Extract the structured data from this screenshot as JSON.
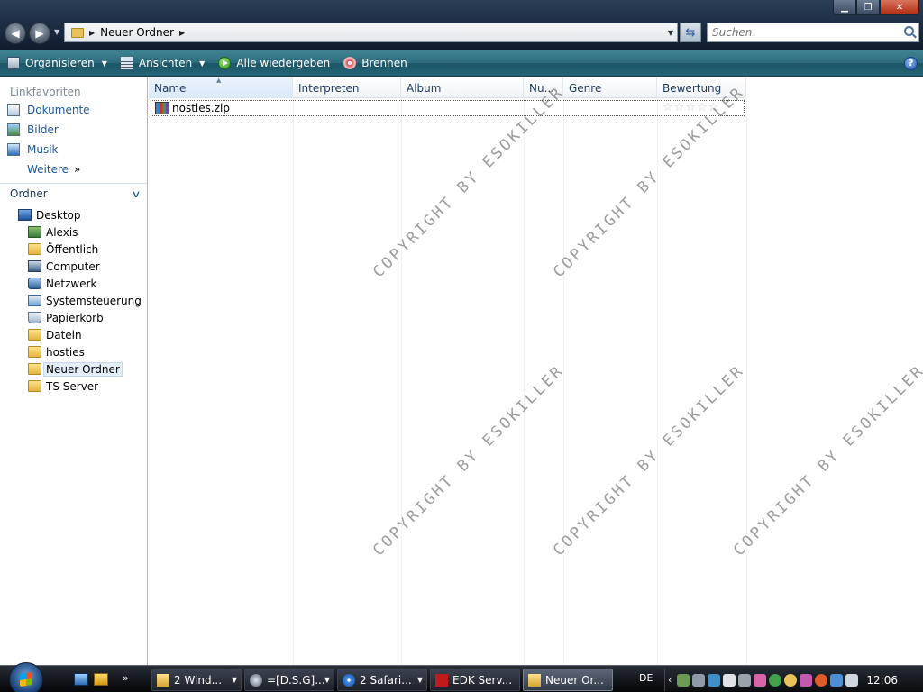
{
  "window": {
    "controls": {
      "minimize": "▁",
      "maximize": "❐",
      "close": "✕"
    }
  },
  "nav": {
    "back_icon": "◀",
    "forward_icon": "▶"
  },
  "address": {
    "path": "Neuer Ordner",
    "separator": "▶"
  },
  "search": {
    "placeholder": "Suchen"
  },
  "toolbar": {
    "organize": "Organisieren",
    "views": "Ansichten",
    "play_all": "Alle wiedergeben",
    "burn": "Brennen",
    "help": "?"
  },
  "sidebar": {
    "favorites_title": "Linkfavoriten",
    "favorites": [
      "Dokumente",
      "Bilder",
      "Musik"
    ],
    "more": "Weitere",
    "more_icon": "»",
    "folders_title": "Ordner",
    "tree_root": "Desktop",
    "tree_items": [
      "Alexis",
      "Öffentlich",
      "Computer",
      "Netzwerk",
      "Systemsteuerung",
      "Papierkorb",
      "Datein",
      "hosties",
      "Neuer Ordner",
      "TS Server"
    ],
    "selected": "Neuer Ordner"
  },
  "columns": [
    "Name",
    "Interpreten",
    "Album",
    "Nu...",
    "Genre",
    "Bewertung"
  ],
  "files": [
    {
      "name": "nosties.zip",
      "rating": 0
    }
  ],
  "watermark": "COPYRIGHT BY ESOKILLER",
  "taskbar": {
    "tasks": [
      "2 Wind...",
      "=[D.S.G]...",
      "2 Safari...",
      "EDK Serv...",
      "Neuer Or..."
    ],
    "language": "DE",
    "clock": "12:06"
  },
  "colors": {
    "accent": "#246577",
    "link": "#1d5aa0",
    "taskbar": "#14171d"
  }
}
